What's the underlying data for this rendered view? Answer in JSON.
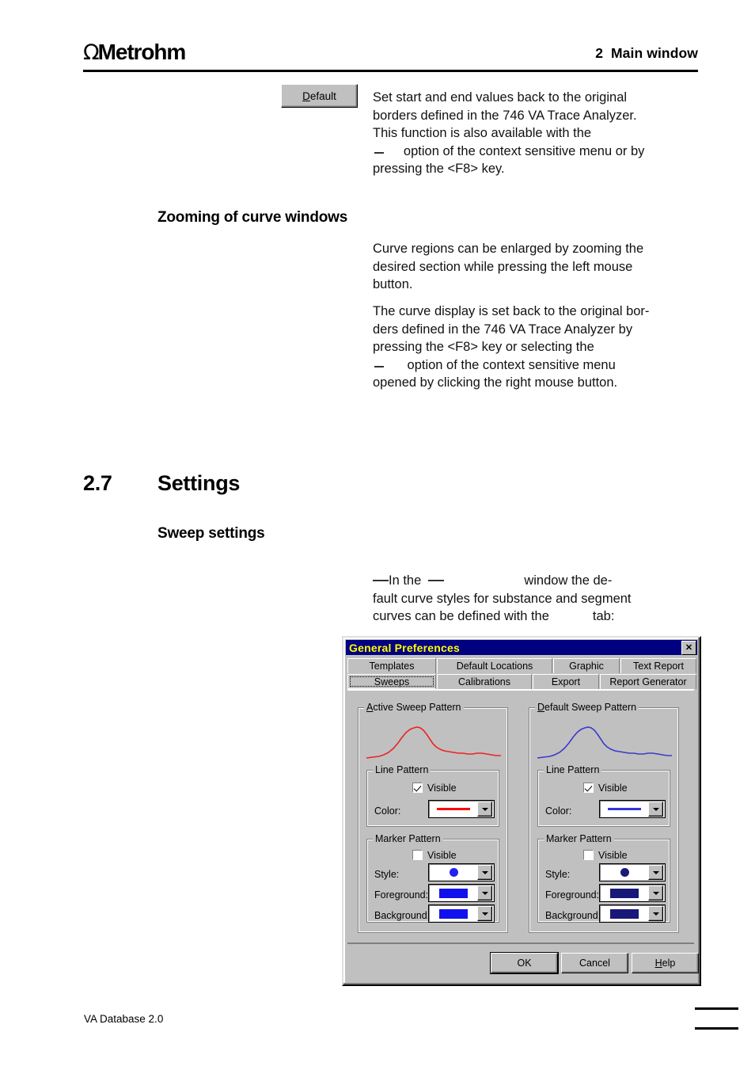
{
  "header": {
    "logo_omega": "Ω",
    "logo_text": "Metrohm",
    "chapter": "2  Main window"
  },
  "margin_button": {
    "label_pre": "D",
    "label_post": "efault",
    "name": "Default"
  },
  "intro_paragraph": {
    "line1": "Set start and end values back to the original",
    "line2": "borders defined in the 746 VA Trace Analyzer.",
    "line3": "This function is also available with the",
    "line4_post": "option of the context sensitive menu or by",
    "line5": "pressing the <F8> key."
  },
  "section_zoom": {
    "heading": "Zooming of curve windows",
    "p1_line1": "Curve regions can be enlarged by zooming the",
    "p1_line2": "desired section while pressing the left mouse",
    "p1_line3": "button.",
    "p2_line1": "The curve display is set back to the original bor-",
    "p2_line2": "ders defined in the 746 VA Trace Analyzer by",
    "p2_line3": "pressing the <F8> key or selecting the",
    "p2_line4_post": "option of the context sensitive menu",
    "p2_line5": "opened by clicking the right mouse button."
  },
  "section_settings": {
    "number": "2.7",
    "title": "Settings",
    "subheading": "Sweep settings",
    "p_line1_a": "In the",
    "p_line1_b": "window the de-",
    "p_line2": "fault curve styles for substance and segment",
    "p_line3_a": "curves can be defined with the",
    "p_line3_b": "tab:"
  },
  "dialog": {
    "title": "General Preferences",
    "close_label": "✕",
    "tabs_row1": [
      "Templates",
      "Default Locations",
      "Graphic",
      "Text Report"
    ],
    "tabs_row2": [
      "Sweeps",
      "Calibrations",
      "Export",
      "Report Generator"
    ],
    "selected_tab": "Sweeps",
    "groups": [
      {
        "legend_accel": "A",
        "legend_rest": "ctive Sweep Pattern",
        "curve_color": "#EE2222",
        "line_pattern": {
          "legend": "Line Pattern",
          "visible_label": "Visible",
          "visible_checked": true,
          "color_label": "Color:",
          "color_value": "#FF0000"
        },
        "marker_pattern": {
          "legend": "Marker Pattern",
          "visible_label": "Visible",
          "visible_checked": false,
          "style_label": "Style:",
          "style_value": "#2222EE",
          "foreground_label": "Foreground:",
          "foreground_value": "#1111EE",
          "background_label": "Background:",
          "background_value": "#1111EE"
        }
      },
      {
        "legend_accel": "D",
        "legend_rest": "efault Sweep Pattern",
        "curve_color": "#3A3ACC",
        "line_pattern": {
          "legend": "Line Pattern",
          "visible_label": "Visible",
          "visible_checked": true,
          "color_label": "Color:",
          "color_value": "#3333DD"
        },
        "marker_pattern": {
          "legend": "Marker Pattern",
          "visible_label": "Visible",
          "visible_checked": false,
          "style_label": "Style:",
          "style_value": "#1A1A7A",
          "foreground_label": "Foreground:",
          "foreground_value": "#181878",
          "background_label": "Background:",
          "background_value": "#181878"
        }
      }
    ],
    "buttons": {
      "ok": "OK",
      "cancel": "Cancel",
      "help_accel": "H",
      "help_rest": "elp"
    }
  },
  "footer": {
    "product": "VA Database 2.0"
  },
  "colors": {
    "titlebar": "#000080",
    "titlebar_text": "#FFFF00",
    "dialog_face": "#C0C0C0",
    "active_curve": "#EE2222",
    "default_curve": "#3A3ACC"
  }
}
